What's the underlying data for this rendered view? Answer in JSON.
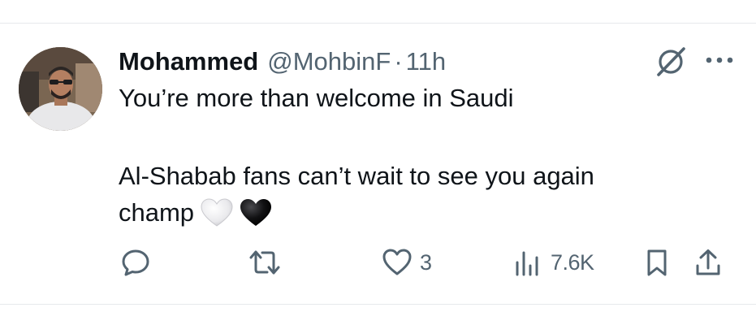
{
  "tweet": {
    "author": {
      "display_name": "Mohammed",
      "handle": "@MohbinF",
      "separator": "·",
      "time": "11h"
    },
    "text": {
      "line1": "You’re more than welcome in Saudi",
      "line2": "Al-Shabab fans can’t wait to see you again",
      "line3": "champ"
    },
    "emojis": [
      "white-heart",
      "black-heart"
    ],
    "actions": {
      "reply": {
        "icon": "reply-icon",
        "count": ""
      },
      "retweet": {
        "icon": "retweet-icon",
        "count": ""
      },
      "like": {
        "icon": "heart-icon",
        "count": "3"
      },
      "views": {
        "icon": "views-icon",
        "count": "7.6K"
      },
      "bookmark": {
        "icon": "bookmark-icon"
      },
      "share": {
        "icon": "share-icon"
      }
    },
    "header_icons": [
      "grok-icon",
      "more-icon"
    ]
  },
  "colors": {
    "text": "#0f1419",
    "secondary": "#536471",
    "divider": "#e6e9ec"
  }
}
